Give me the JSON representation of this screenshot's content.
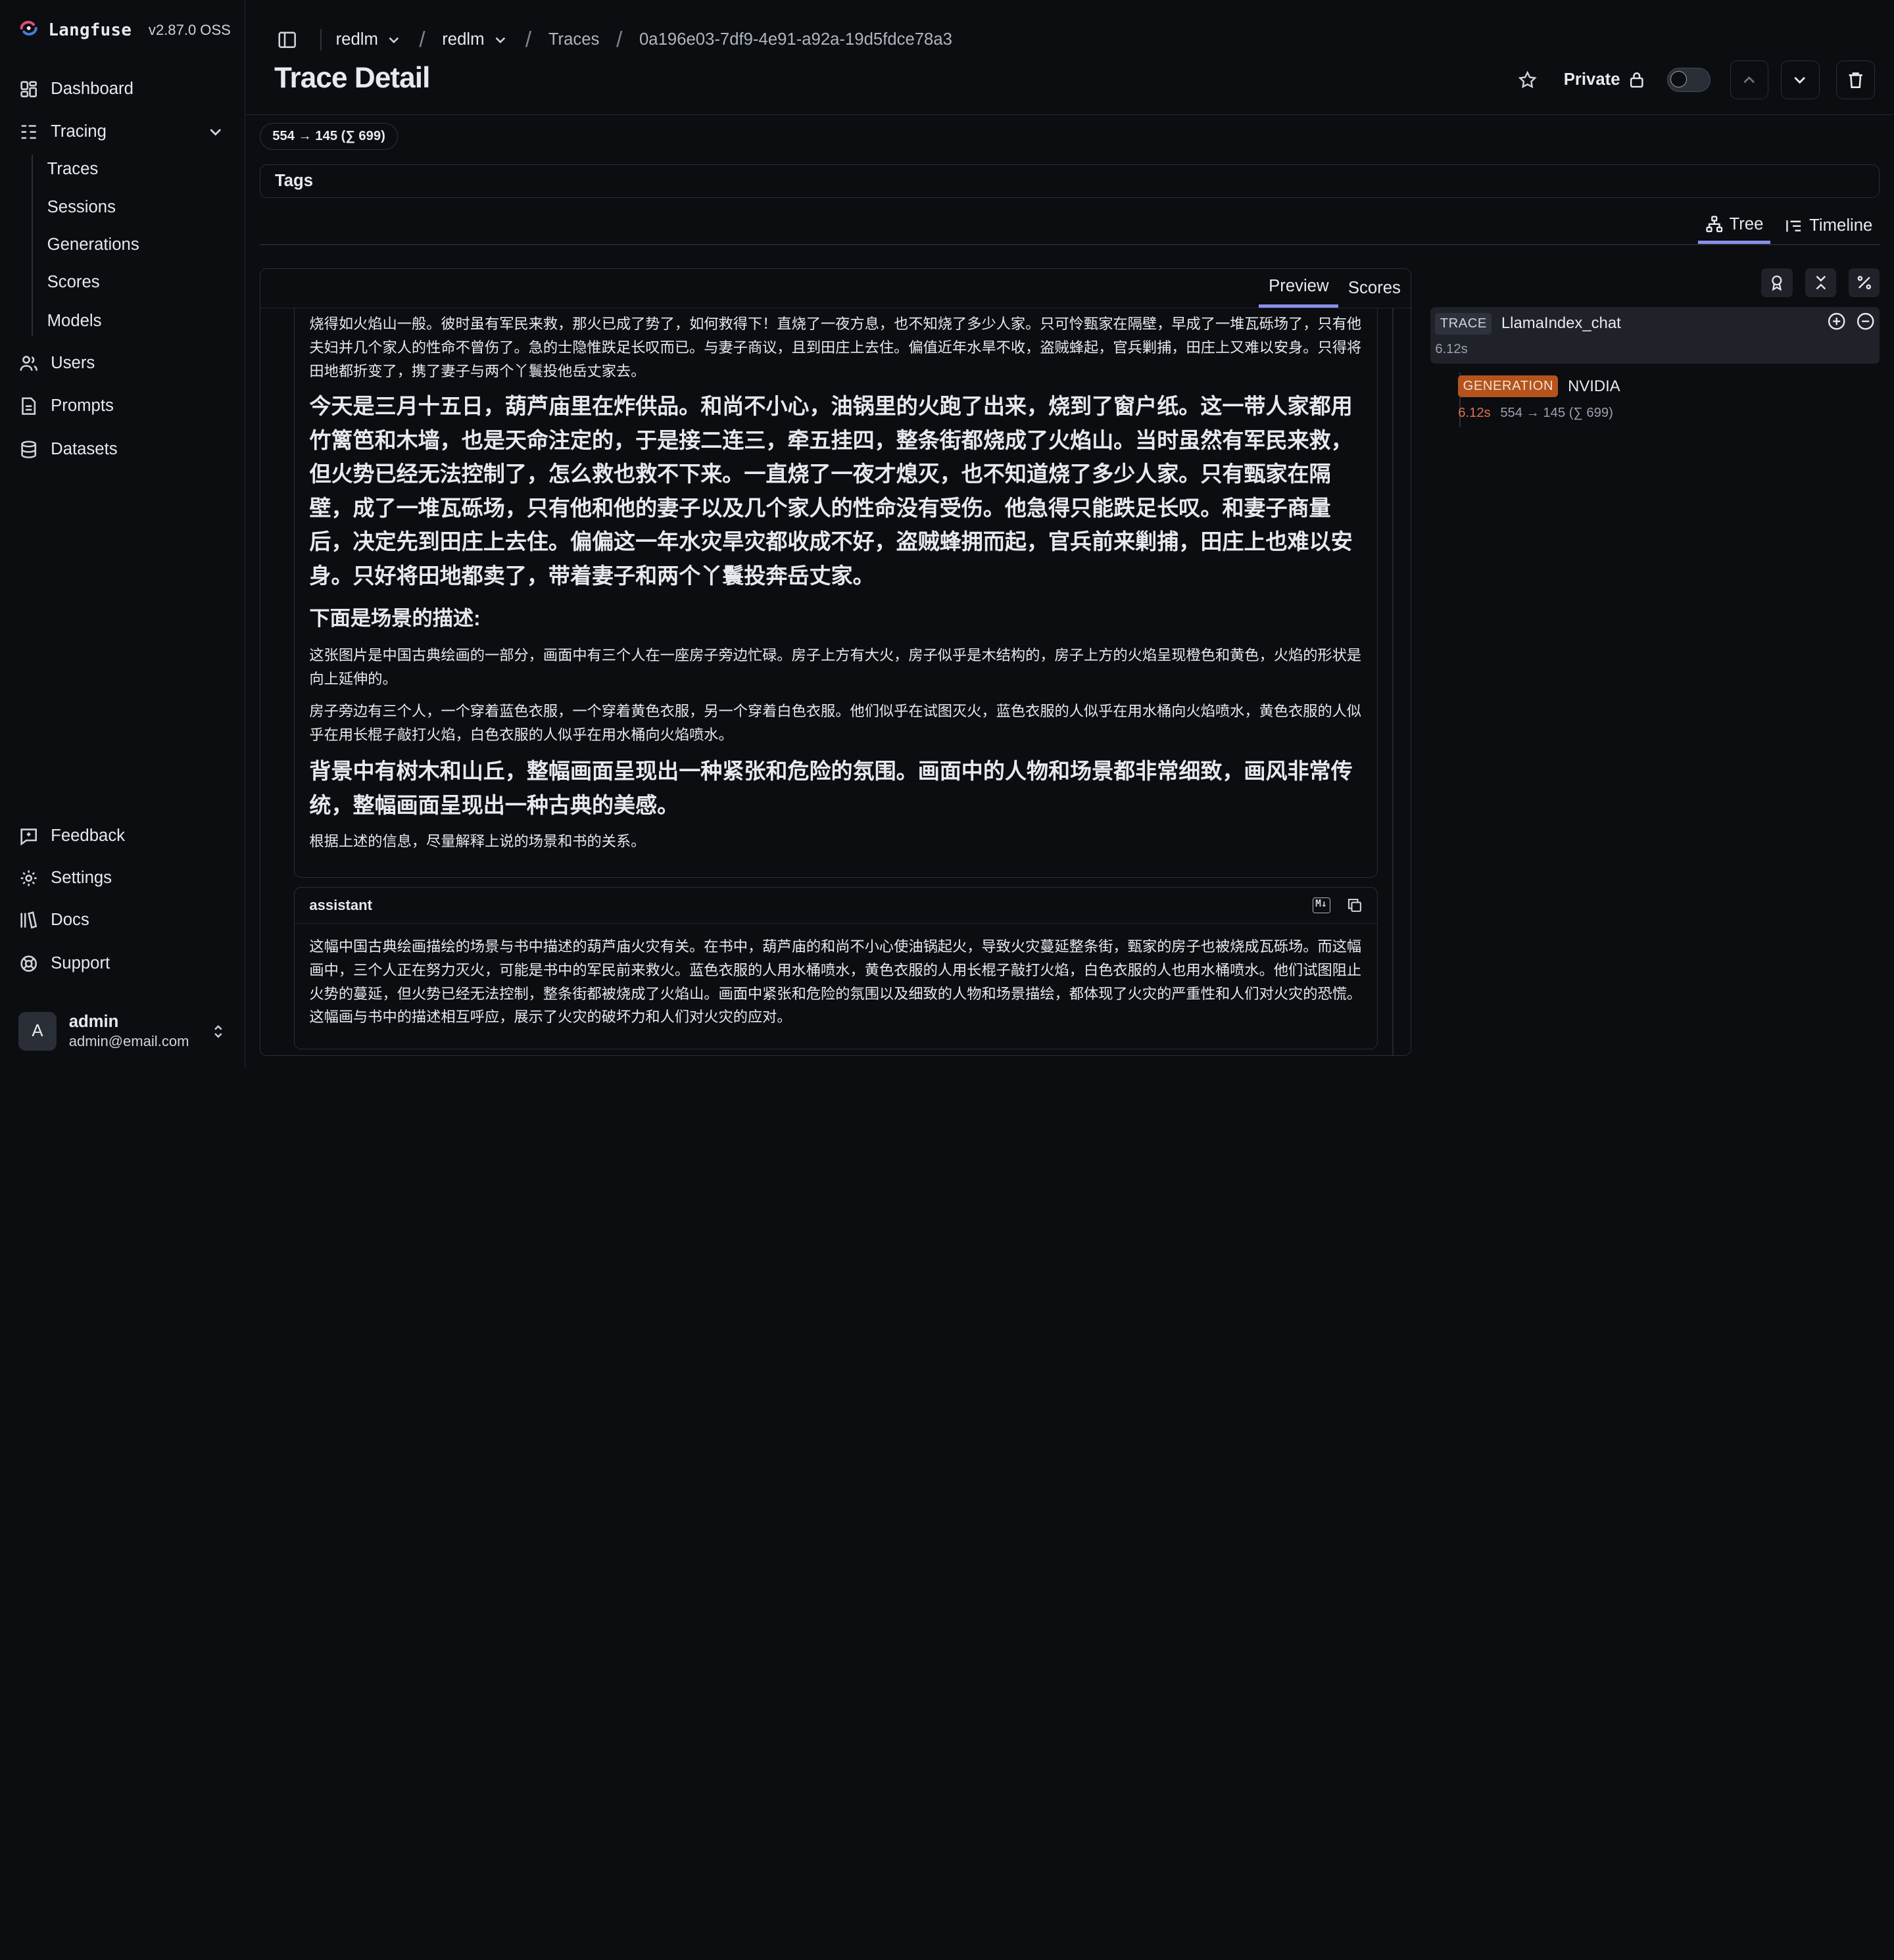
{
  "brand": {
    "name": "Langfuse",
    "version": "v2.87.0 OSS"
  },
  "sidebar": {
    "items": [
      {
        "label": "Dashboard",
        "icon": "dashboard-icon"
      },
      {
        "label": "Tracing",
        "icon": "tracing-icon"
      },
      {
        "label": "Users",
        "icon": "users-icon"
      },
      {
        "label": "Prompts",
        "icon": "prompts-icon"
      },
      {
        "label": "Datasets",
        "icon": "datasets-icon"
      }
    ],
    "tracing_sub": [
      "Traces",
      "Sessions",
      "Generations",
      "Scores",
      "Models"
    ],
    "bottom": [
      {
        "label": "Feedback",
        "icon": "feedback-icon"
      },
      {
        "label": "Settings",
        "icon": "settings-icon"
      },
      {
        "label": "Docs",
        "icon": "docs-icon"
      },
      {
        "label": "Support",
        "icon": "support-icon"
      }
    ],
    "user": {
      "initial": "A",
      "name": "admin",
      "email": "admin@email.com"
    }
  },
  "header": {
    "breadcrumbs": [
      "redlm",
      "redlm",
      "Traces",
      "0a196e03-7df9-4e91-a92a-19d5fdce78a3"
    ],
    "title": "Trace Detail",
    "private_label": "Private"
  },
  "trace": {
    "usage": "554 → 145 (∑ 699)",
    "tags_label": "Tags",
    "view_tabs": [
      "Tree",
      "Timeline"
    ]
  },
  "preview": {
    "tabs": [
      "Preview",
      "Scores"
    ],
    "user_paragraphs": [
      {
        "style": "small",
        "text": "烧得如火焰山一般。彼时虽有军民来救，那火已成了势了，如何救得下！直烧了一夜方息，也不知烧了多少人家。只可怜甄家在隔壁，早成了一堆瓦砾场了，只有他夫妇并几个家人的性命不曾伤了。急的士隐惟跌足长叹而已。与妻子商议，且到田庄上去住。偏值近年水旱不收，盗贼蜂起，官兵剿捕，田庄上又难以安身。只得将田地都折变了，携了妻子与两个丫鬟投他岳丈家去。"
      },
      {
        "style": "big",
        "text": "今天是三月十五日，葫芦庙里在炸供品。和尚不小心，油锅里的火跑了出来，烧到了窗户纸。这一带人家都用竹篱笆和木墙，也是天命注定的，于是接二连三，牵五挂四，整条街都烧成了火焰山。当时虽然有军民来救，但火势已经无法控制了，怎么救也救不下来。一直烧了一夜才熄灭，也不知道烧了多少人家。只有甄家在隔壁，成了一堆瓦砾场，只有他和他的妻子以及几个家人的性命没有受伤。他急得只能跌足长叹。和妻子商量后，决定先到田庄上去住。偏偏这一年水灾旱灾都收成不好，盗贼蜂拥而起，官兵前来剿捕，田庄上也难以安身。只好将田地都卖了，带着妻子和两个丫鬟投奔岳丈家。"
      },
      {
        "style": "h3",
        "text": "下面是场景的描述:"
      },
      {
        "style": "small",
        "text": "这张图片是中国古典绘画的一部分，画面中有三个人在一座房子旁边忙碌。房子上方有大火，房子似乎是木结构的，房子上方的火焰呈现橙色和黄色，火焰的形状是向上延伸的。"
      },
      {
        "style": "small",
        "text": "房子旁边有三个人，一个穿着蓝色衣服，一个穿着黄色衣服，另一个穿着白色衣服。他们似乎在试图灭火，蓝色衣服的人似乎在用水桶向火焰喷水，黄色衣服的人似乎在用长棍子敲打火焰，白色衣服的人似乎在用水桶向火焰喷水。"
      },
      {
        "style": "big",
        "text": "背景中有树木和山丘，整幅画面呈现出一种紧张和危险的氛围。画面中的人物和场景都非常细致，画风非常传统，整幅画面呈现出一种古典的美感。"
      },
      {
        "style": "small",
        "text": "根据上述的信息，尽量解释上说的场景和书的关系。"
      }
    ],
    "assistant": {
      "role": "assistant",
      "md_badge": "M↓",
      "text": "这幅中国古典绘画描绘的场景与书中描述的葫芦庙火灾有关。在书中，葫芦庙的和尚不小心使油锅起火，导致火灾蔓延整条街，甄家的房子也被烧成瓦砾场。而这幅画中，三个人正在努力灭火，可能是书中的军民前来救火。蓝色衣服的人用水桶喷水，黄色衣服的人用长棍子敲打火焰，白色衣服的人也用水桶喷水。他们试图阻止火势的蔓延，但火势已经无法控制，整条街都被烧成了火焰山。画面中紧张和危险的氛围以及细致的人物和场景描绘，都体现了火灾的严重性和人们对火灾的恐慌。这幅画与书中的描述相互呼应，展示了火灾的破坏力和人们对火灾的应对。"
    }
  },
  "tree": {
    "root": {
      "type": "TRACE",
      "name": "LlamaIndex_chat",
      "latency": "6.12s"
    },
    "child": {
      "type": "GENERATION",
      "name": "NVIDIA",
      "latency": "6.12s",
      "usage": "554 → 145 (∑ 699)"
    }
  },
  "colors": {
    "accent": "#8b8fe8",
    "generation": "#b4541c",
    "latency_warn": "#e0704e",
    "background": "#0b0d11"
  }
}
